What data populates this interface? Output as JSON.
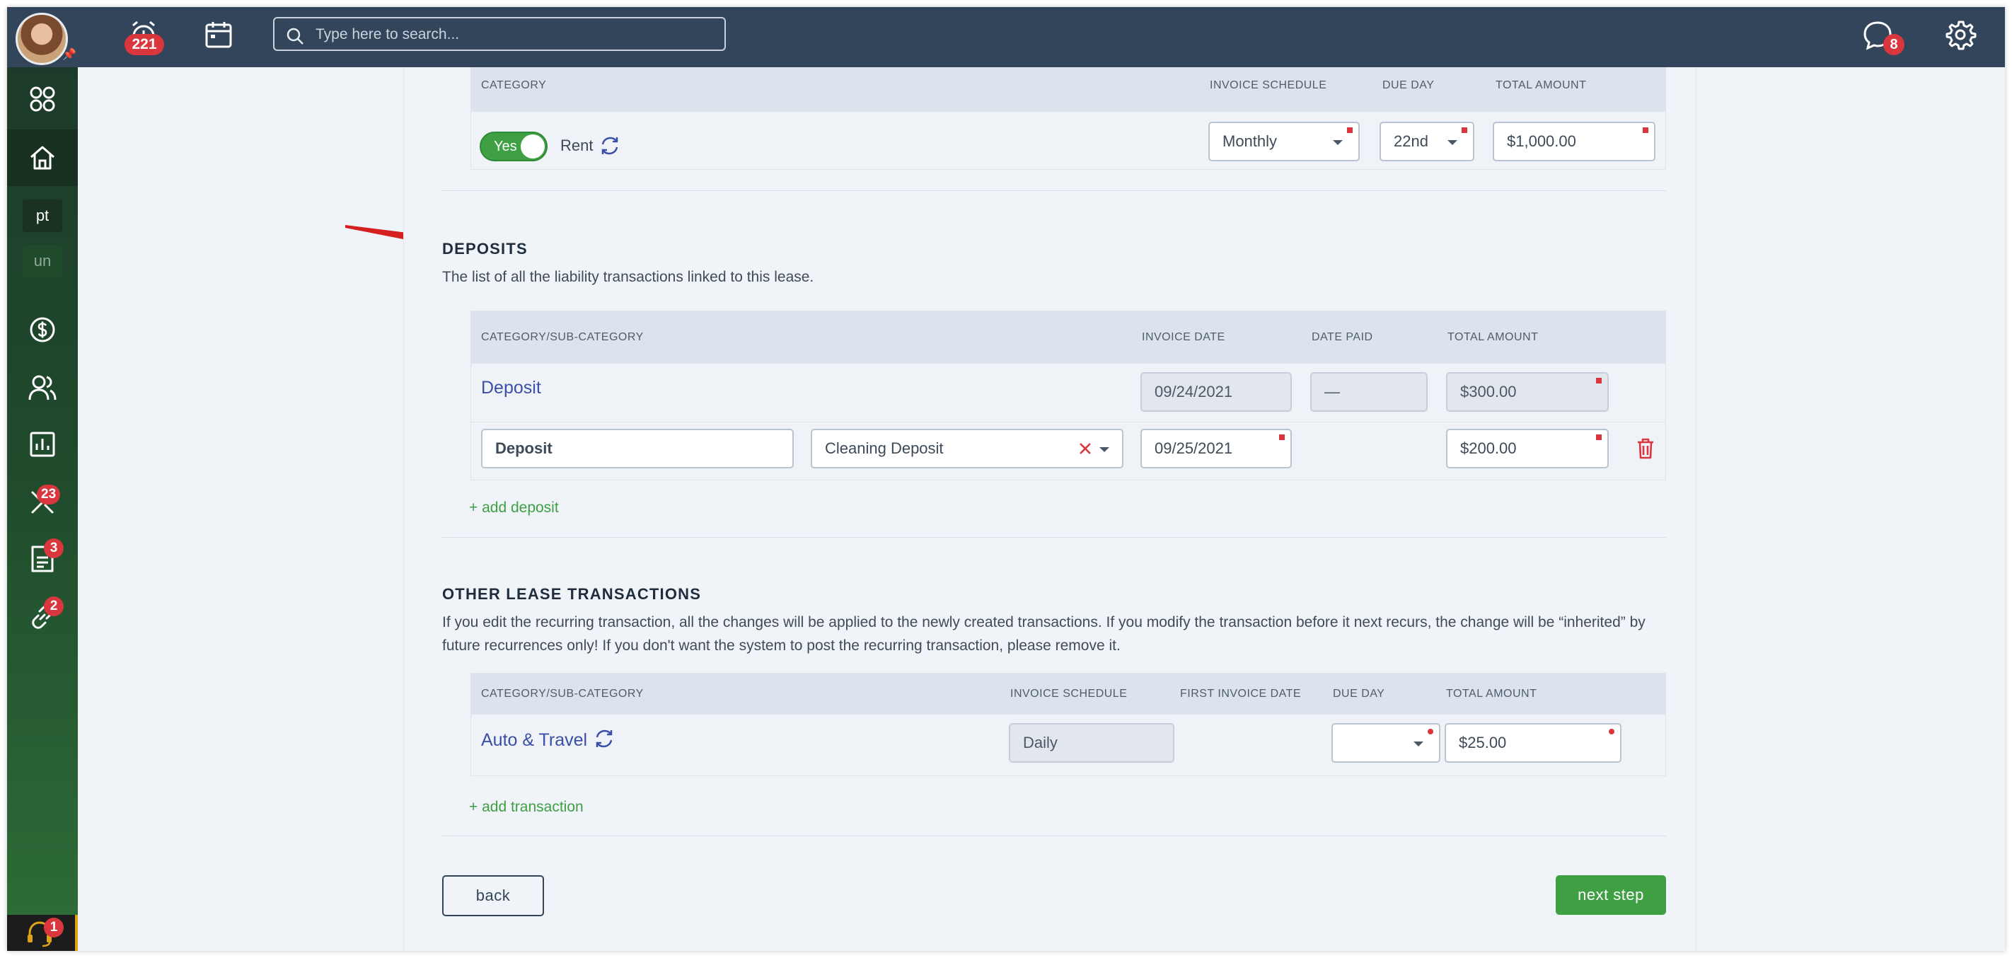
{
  "topbar": {
    "alerts_count": "221",
    "search_placeholder": "Type here to search...",
    "messages_count": "8"
  },
  "sidebar": {
    "chip_pt": "pt",
    "chip_un": "un",
    "maintenance_badge": "23",
    "documents_badge": "3",
    "links_badge": "2",
    "support_badge": "1"
  },
  "recurring": {
    "headers": {
      "category": "CATEGORY",
      "invoice_schedule": "INVOICE SCHEDULE",
      "due_day": "DUE DAY",
      "total_amount": "TOTAL AMOUNT"
    },
    "toggle_label": "Yes",
    "category": "Rent",
    "schedule": "Monthly",
    "due_day": "22nd",
    "amount": "$1,000.00"
  },
  "deposits": {
    "title": "DEPOSITS",
    "description": "The list of all the liability transactions linked to this lease.",
    "headers": {
      "category": "CATEGORY/SUB-CATEGORY",
      "invoice_date": "INVOICE DATE",
      "date_paid": "DATE PAID",
      "total_amount": "TOTAL AMOUNT"
    },
    "rows": [
      {
        "category": "Deposit",
        "invoice_date": "09/24/2021",
        "date_paid": "—",
        "amount": "$300.00"
      },
      {
        "category": "Deposit",
        "subcategory": "Cleaning Deposit",
        "invoice_date": "09/25/2021",
        "amount": "$200.00"
      }
    ],
    "add_label": "+ add deposit"
  },
  "other": {
    "title": "OTHER LEASE TRANSACTIONS",
    "description": "If you edit the recurring transaction, all the changes will be applied to the newly created transactions. If you modify the transaction before it next recurs, the change will be “inherited” by future recurrences only! If you don't want the system to post the recurring transaction, please remove it.",
    "headers": {
      "category": "CATEGORY/SUB-CATEGORY",
      "invoice_schedule": "INVOICE SCHEDULE",
      "first_invoice_date": "FIRST INVOICE DATE",
      "due_day": "DUE DAY",
      "total_amount": "TOTAL AMOUNT"
    },
    "row": {
      "category": "Auto & Travel",
      "schedule": "Daily",
      "due_day": "",
      "amount": "$25.00"
    },
    "add_label": "+ add transaction"
  },
  "footer": {
    "back_label": "back",
    "next_label": "next step"
  },
  "colors": {
    "topbar": "#33455a",
    "accent_green": "#3ea043",
    "badge_red": "#d9363e",
    "link_blue": "#3b4fa8",
    "arrow_red": "#d61f1f"
  }
}
